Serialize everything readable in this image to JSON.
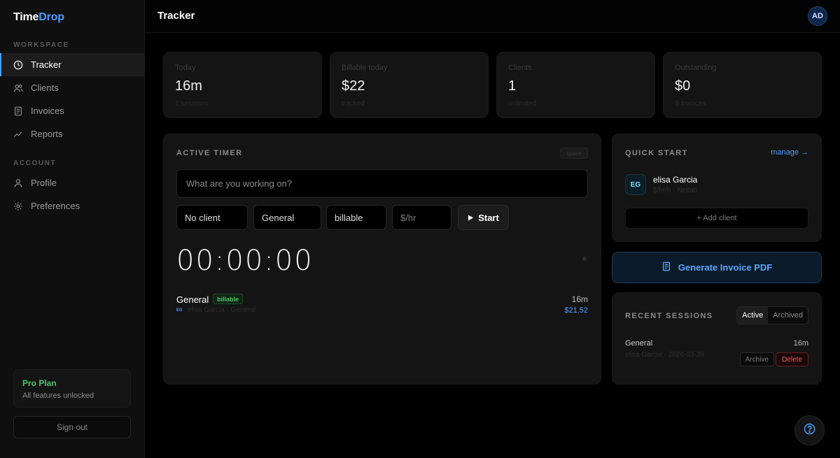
{
  "app": {
    "logo_main": "Time",
    "logo_accent": "Drop"
  },
  "sidebar": {
    "workspace_label": "WORKSPACE",
    "account_label": "ACCOUNT",
    "items": [
      {
        "label": "Tracker",
        "icon": "clock-icon"
      },
      {
        "label": "Clients",
        "icon": "users-icon"
      },
      {
        "label": "Invoices",
        "icon": "document-icon"
      },
      {
        "label": "Reports",
        "icon": "chart-line-icon"
      },
      {
        "label": "Profile",
        "icon": "user-icon"
      },
      {
        "label": "Preferences",
        "icon": "gear-icon"
      }
    ],
    "plan": {
      "title": "Pro Plan",
      "subtitle": "All features unlocked"
    },
    "signout_label": "Sign out"
  },
  "header": {
    "title": "Tracker",
    "avatar_initials": "AD"
  },
  "stats": [
    {
      "label": "Today",
      "value": "16m",
      "sub": "1 sessions"
    },
    {
      "label": "Billable today",
      "value": "$22",
      "sub": "tracked"
    },
    {
      "label": "Clients",
      "value": "1",
      "sub": "unlimited"
    },
    {
      "label": "Outstanding",
      "value": "$0",
      "sub": "0 invoices"
    }
  ],
  "timer": {
    "title": "ACTIVE TIMER",
    "badge": "space",
    "task_placeholder": "What are you working on?",
    "client_select": "No client",
    "category_select": "General",
    "billing_select": "billable",
    "rate_placeholder": "$/hr",
    "start_label": "Start",
    "clock": "00:00:00",
    "entry": {
      "title": "General",
      "tag": "billable",
      "client_initials": "EG",
      "meta": "elisa Garcia · General",
      "duration": "16m",
      "amount": "$21.52"
    }
  },
  "quick_start": {
    "title": "QUICK START",
    "manage_label": "manage →",
    "client": {
      "initials": "EG",
      "name": "elisa Garcia",
      "sub": "$/hr/h · Netlab"
    },
    "add_client_label": "+ Add client"
  },
  "invoice_button_label": "Generate Invoice PDF",
  "recent": {
    "title": "RECENT SESSIONS",
    "tabs": [
      "Active",
      "Archived"
    ],
    "session": {
      "title": "General",
      "meta": "elisa Garcia · 2026-03-20",
      "duration": "16m",
      "archive_label": "Archive",
      "delete_label": "Delete"
    }
  },
  "colors": {
    "accent": "#4a9eff",
    "success": "#4ec46b",
    "danger": "#ff5555"
  }
}
